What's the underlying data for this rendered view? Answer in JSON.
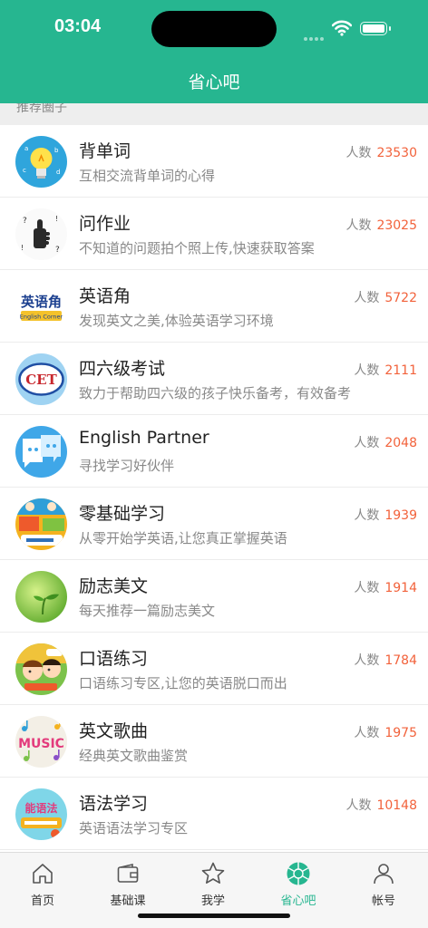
{
  "status_bar": {
    "time": "03:04"
  },
  "header": {
    "title": "省心吧"
  },
  "section": {
    "title": "推荐圈子"
  },
  "count_label": "人数",
  "circles": [
    {
      "title": "背单词",
      "description": "互相交流背单词的心得",
      "count": "23530",
      "icon": "lightbulb-icon"
    },
    {
      "title": "问作业",
      "description": "不知道的问题拍个照上传,快速获取答案",
      "count": "23025",
      "icon": "thumbs-up-icon"
    },
    {
      "title": "英语角",
      "description": "发现英文之美,体验英语学习环境",
      "count": "5722",
      "icon": "english-corner-logo",
      "logo_text": "英语角",
      "logo_subtext": "English Corner"
    },
    {
      "title": "四六级考试",
      "description": "致力于帮助四六级的孩子快乐备考，有效备考",
      "count": "2111",
      "icon": "cet-logo",
      "logo_text": "CET"
    },
    {
      "title": "English Partner",
      "description": "寻找学习好伙伴",
      "count": "2048",
      "icon": "chat-faces-icon"
    },
    {
      "title": "零基础学习",
      "description": "从零开始学英语,让您真正掌握英语",
      "count": "1939",
      "icon": "comic-cover-icon"
    },
    {
      "title": "励志美文",
      "description": "每天推荐一篇励志美文",
      "count": "1914",
      "icon": "sprout-icon"
    },
    {
      "title": "口语练习",
      "description": "口语练习专区,让您的英语脱口而出",
      "count": "1784",
      "icon": "kids-talk-icon"
    },
    {
      "title": "英文歌曲",
      "description": "经典英文歌曲鉴赏",
      "count": "1975",
      "icon": "music-icon",
      "logo_text": "MUSIC"
    },
    {
      "title": "语法学习",
      "description": "英语语法学习专区",
      "count": "10148",
      "icon": "grammar-cover-icon",
      "logo_text": "能语法"
    }
  ],
  "tabs": [
    {
      "label": "首页",
      "icon": "home-icon",
      "active": false
    },
    {
      "label": "基础课",
      "icon": "wallet-icon",
      "active": false
    },
    {
      "label": "我学",
      "icon": "star-icon",
      "active": false
    },
    {
      "label": "省心吧",
      "icon": "aperture-icon",
      "active": true
    },
    {
      "label": "帐号",
      "icon": "person-icon",
      "active": false
    }
  ],
  "colors": {
    "accent": "#26b690",
    "count_number": "#f2623b",
    "text_secondary": "#888888"
  }
}
